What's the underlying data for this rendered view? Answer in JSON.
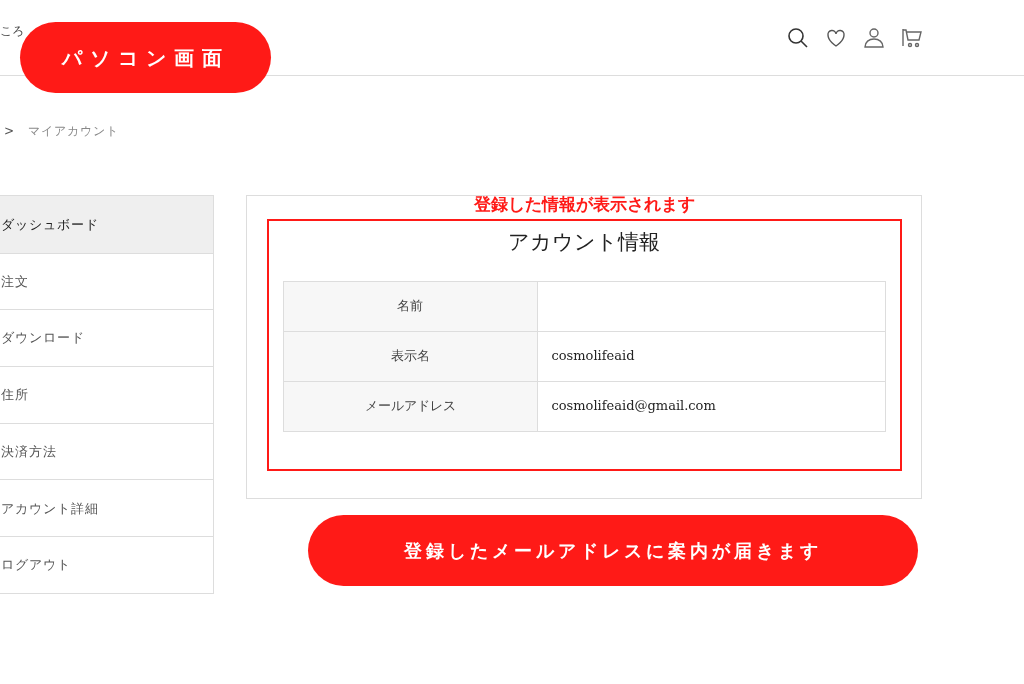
{
  "header": {
    "logo_text": "ころ"
  },
  "annotation_badge": "パソコン画面",
  "breadcrumb": {
    "separator": ">",
    "current": "マイアカウント"
  },
  "sidebar": {
    "items": [
      {
        "label": "ダッシュボード",
        "selected": true
      },
      {
        "label": "注文",
        "selected": false
      },
      {
        "label": "ダウンロード",
        "selected": false
      },
      {
        "label": "住所",
        "selected": false
      },
      {
        "label": "決済方法",
        "selected": false
      },
      {
        "label": "アカウント詳細",
        "selected": false
      },
      {
        "label": "ログアウト",
        "selected": false
      }
    ]
  },
  "panel": {
    "annotation": "登録した情報が表示されます",
    "title": "アカウント情報",
    "rows": [
      {
        "label": "名前",
        "value": ""
      },
      {
        "label": "表示名",
        "value": "cosmolifeaid"
      },
      {
        "label": "メールアドレス",
        "value": "cosmolifeaid@gmail.com"
      }
    ]
  },
  "bottom_annotation": "登録したメールアドレスに案内が届きます"
}
